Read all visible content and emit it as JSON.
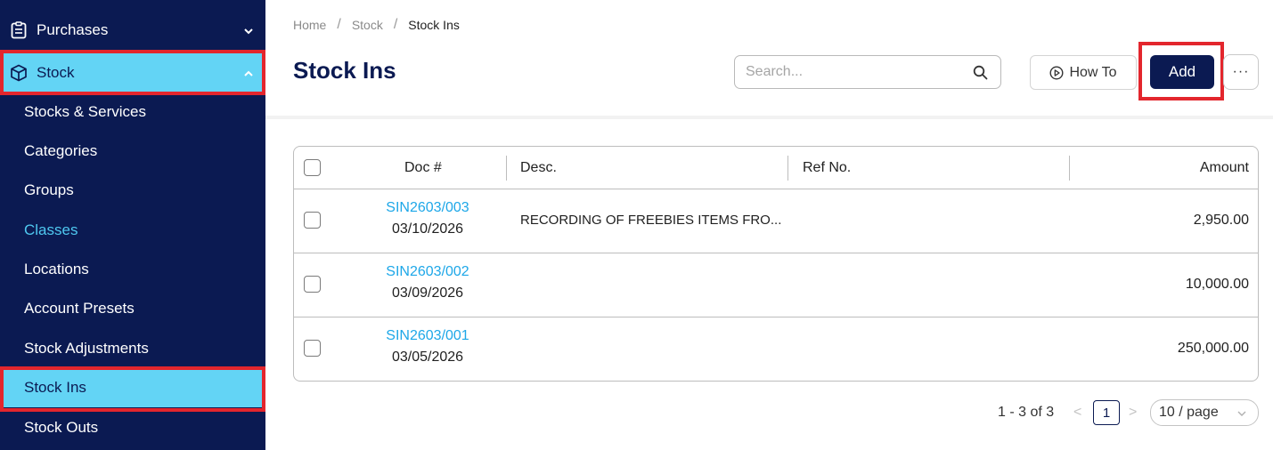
{
  "sidebar": {
    "purchases": "Purchases",
    "stock": "Stock",
    "items": [
      "Stocks & Services",
      "Categories",
      "Groups",
      "Classes",
      "Locations",
      "Account Presets",
      "Stock Adjustments",
      "Stock Ins",
      "Stock Outs"
    ],
    "active_item": "Stock Ins",
    "icons": {
      "purchases": "clipboard-icon",
      "stock": "box-icon",
      "purchases_chevron": "chevron-down-icon",
      "stock_chevron": "chevron-up-icon"
    }
  },
  "breadcrumb": [
    "Home",
    "Stock",
    "Stock Ins"
  ],
  "page_title": "Stock Ins",
  "search": {
    "placeholder": "Search..."
  },
  "toolbar": {
    "howto_label": "How To",
    "add_label": "Add",
    "more_label": "···"
  },
  "table": {
    "columns": [
      "Doc #",
      "Desc.",
      "Ref No.",
      "Amount"
    ],
    "rows": [
      {
        "doc_no": "SIN2603/003",
        "date": "03/10/2026",
        "desc": "RECORDING OF FREEBIES ITEMS FRO...",
        "ref": "",
        "amount": "2,950.00"
      },
      {
        "doc_no": "SIN2603/002",
        "date": "03/09/2026",
        "desc": "",
        "ref": "",
        "amount": "10,000.00"
      },
      {
        "doc_no": "SIN2603/001",
        "date": "03/05/2026",
        "desc": "",
        "ref": "",
        "amount": "250,000.00"
      }
    ]
  },
  "pagination": {
    "info": "1 - 3 of 3",
    "prev": "<",
    "current_page": "1",
    "next": ">",
    "page_size": "10 / page"
  },
  "colors": {
    "sidebar_bg": "#0b1a52",
    "active_bg": "#63d4f5",
    "link": "#1da7e8",
    "primary": "#0b1a52",
    "highlight_box": "#e3262d"
  }
}
